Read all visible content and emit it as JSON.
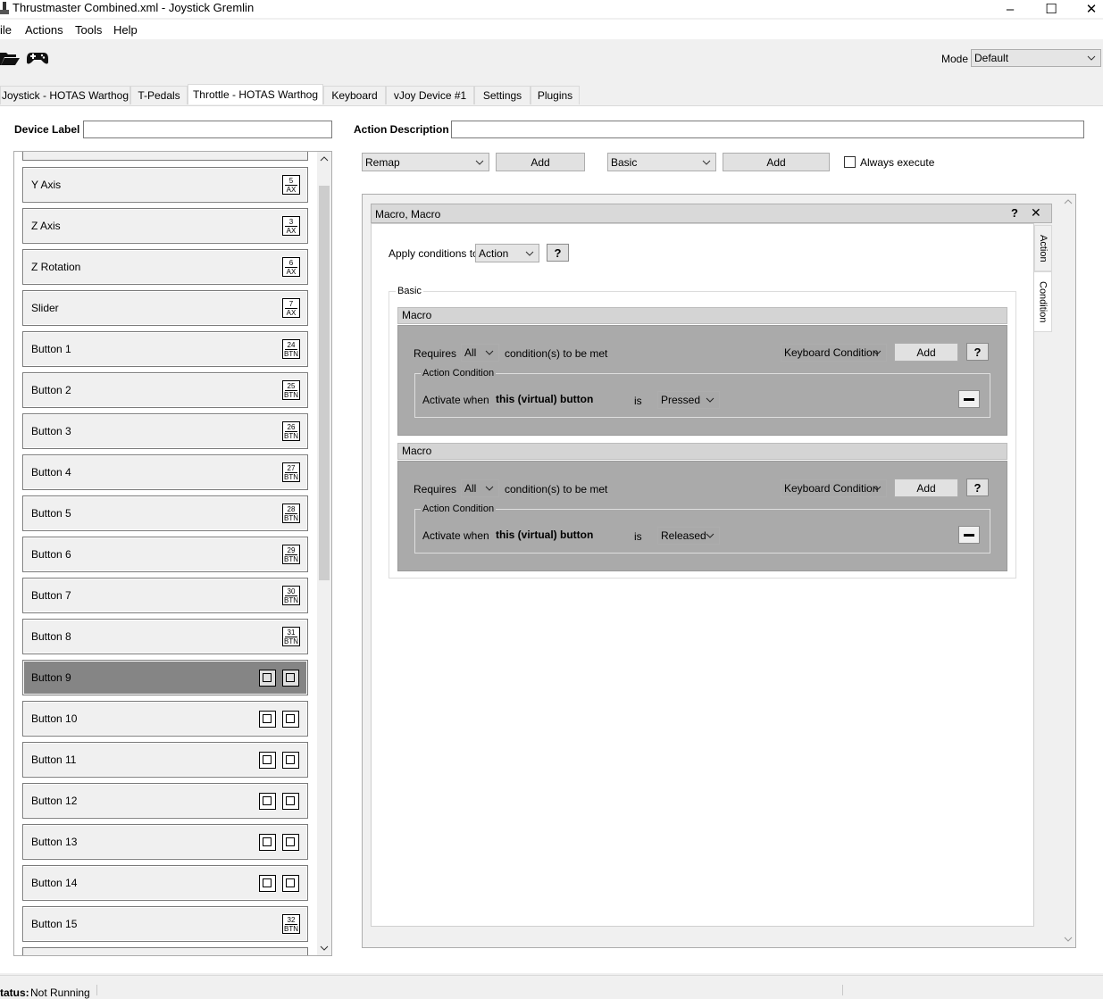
{
  "window": {
    "title": "Thrustmaster Combined.xml - Joystick Gremlin",
    "minimize": "–",
    "maximize": "☐",
    "close": "✕"
  },
  "menu": [
    "ile",
    "Actions",
    "Tools",
    "Help"
  ],
  "toolbar": {
    "open_icon": "folder-open-icon",
    "device_icon": "gamepad-icon",
    "mode_label": "Mode",
    "mode_value": "Default"
  },
  "tabs": [
    {
      "label": "Joystick - HOTAS Warthog",
      "active": false
    },
    {
      "label": "T-Pedals",
      "active": false
    },
    {
      "label": "Throttle - HOTAS Warthog",
      "active": true
    },
    {
      "label": "Keyboard",
      "active": false
    },
    {
      "label": "vJoy Device #1",
      "active": false
    },
    {
      "label": "Settings",
      "active": false
    },
    {
      "label": "Plugins",
      "active": false
    }
  ],
  "left": {
    "device_label": "Device Label",
    "device_value": "",
    "items": [
      {
        "label": "Y Axis",
        "badge_num": "5",
        "badge_type": "AX"
      },
      {
        "label": "Z Axis",
        "badge_num": "3",
        "badge_type": "AX"
      },
      {
        "label": "Z Rotation",
        "badge_num": "6",
        "badge_type": "AX"
      },
      {
        "label": "Slider",
        "badge_num": "7",
        "badge_type": "AX"
      },
      {
        "label": "Button 1",
        "badge_num": "24",
        "badge_type": "BTN"
      },
      {
        "label": "Button 2",
        "badge_num": "25",
        "badge_type": "BTN"
      },
      {
        "label": "Button 3",
        "badge_num": "26",
        "badge_type": "BTN"
      },
      {
        "label": "Button 4",
        "badge_num": "27",
        "badge_type": "BTN"
      },
      {
        "label": "Button 5",
        "badge_num": "28",
        "badge_type": "BTN"
      },
      {
        "label": "Button 6",
        "badge_num": "29",
        "badge_type": "BTN"
      },
      {
        "label": "Button 7",
        "badge_num": "30",
        "badge_type": "BTN"
      },
      {
        "label": "Button 8",
        "badge_num": "31",
        "badge_type": "BTN"
      },
      {
        "label": "Button 9",
        "keyboard_icons": true,
        "selected": true
      },
      {
        "label": "Button 10",
        "keyboard_icons": true
      },
      {
        "label": "Button 11",
        "keyboard_icons": true
      },
      {
        "label": "Button 12",
        "keyboard_icons": true
      },
      {
        "label": "Button 13",
        "keyboard_icons": true
      },
      {
        "label": "Button 14",
        "keyboard_icons": true
      },
      {
        "label": "Button 15",
        "badge_num": "32",
        "badge_type": "BTN"
      }
    ]
  },
  "right": {
    "action_description_label": "Action Description",
    "action_description_value": "",
    "action_select": "Remap",
    "add1": "Add",
    "container_select": "Basic",
    "add2": "Add",
    "always_execute": "Always execute",
    "macro_header": "Macro, Macro",
    "help": "?",
    "close": "✕",
    "vtab_action": "Action",
    "vtab_condition": "Condition",
    "apply_label": "Apply conditions to",
    "apply_value": "Action",
    "group_title": "Basic",
    "macros": [
      {
        "title": "Macro",
        "requires": "Requires",
        "requires_value": "All",
        "met": "condition(s) to be met",
        "cond_type": "Keyboard Condition",
        "add": "Add",
        "help": "?",
        "frame_title": "Action Condition",
        "activate": "Activate when",
        "subject": "this (virtual) button",
        "is": "is",
        "state": "Pressed"
      },
      {
        "title": "Macro",
        "requires": "Requires",
        "requires_value": "All",
        "met": "condition(s) to be met",
        "cond_type": "Keyboard Condition",
        "add": "Add",
        "help": "?",
        "frame_title": "Action Condition",
        "activate": "Activate when",
        "subject": "this (virtual) button",
        "is": "is",
        "state": "Released"
      }
    ]
  },
  "status": {
    "label": "tatus:",
    "value": "Not Running"
  }
}
